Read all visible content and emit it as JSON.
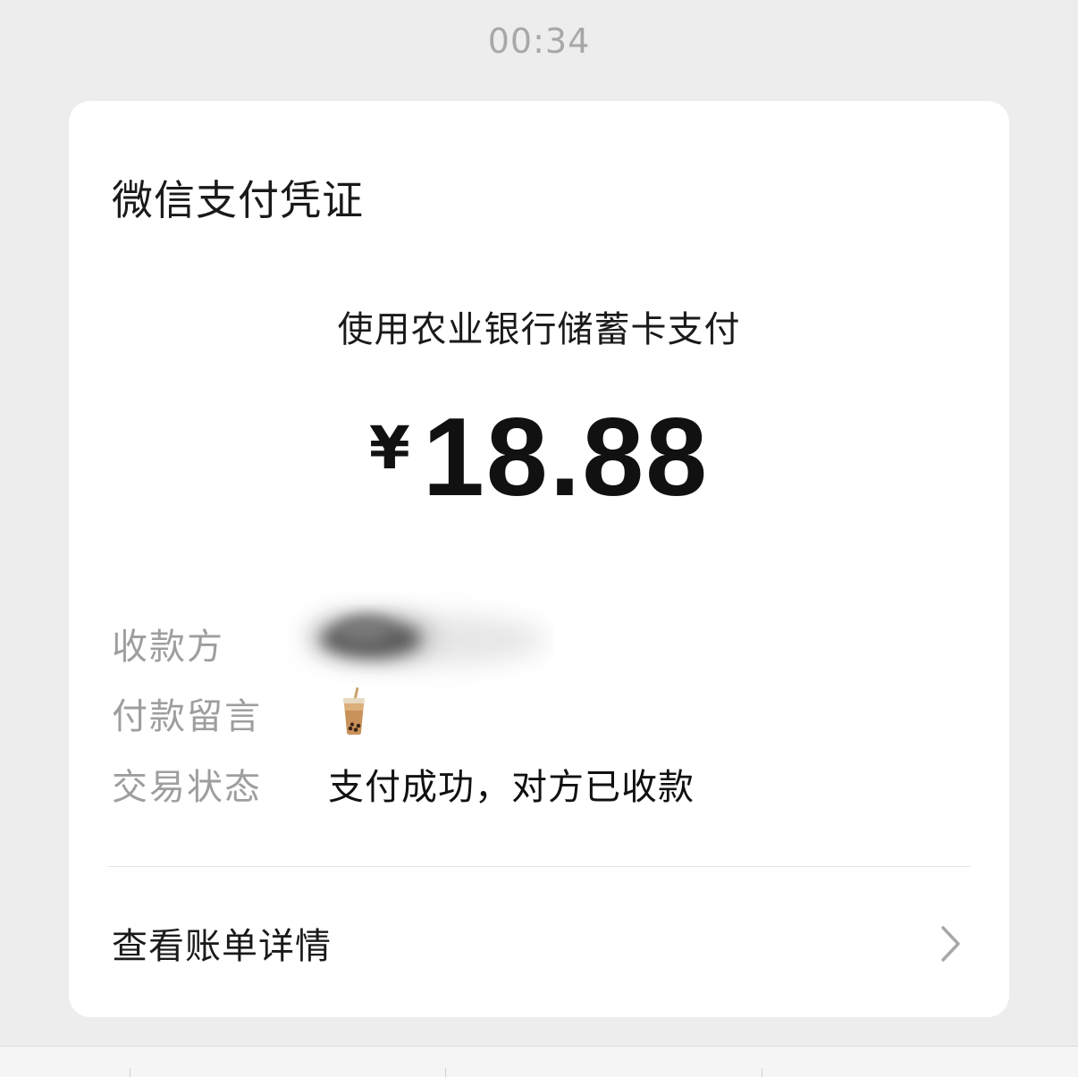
{
  "status_bar": {
    "time": "00:34"
  },
  "receipt": {
    "title": "微信支付凭证",
    "payment_method": "使用农业银行储蓄卡支付",
    "currency_symbol": "¥",
    "amount": "18.88",
    "fields": {
      "payee_label": "收款方",
      "note_label": "付款留言",
      "note_icon": "bubble-tea-emoji",
      "status_label": "交易状态",
      "status_value": "支付成功，对方已收款"
    },
    "details_link": "查看账单详情"
  },
  "colors": {
    "background": "#ededed",
    "card": "#ffffff",
    "label_gray": "#9e9e9e",
    "text_dark": "#111111"
  }
}
